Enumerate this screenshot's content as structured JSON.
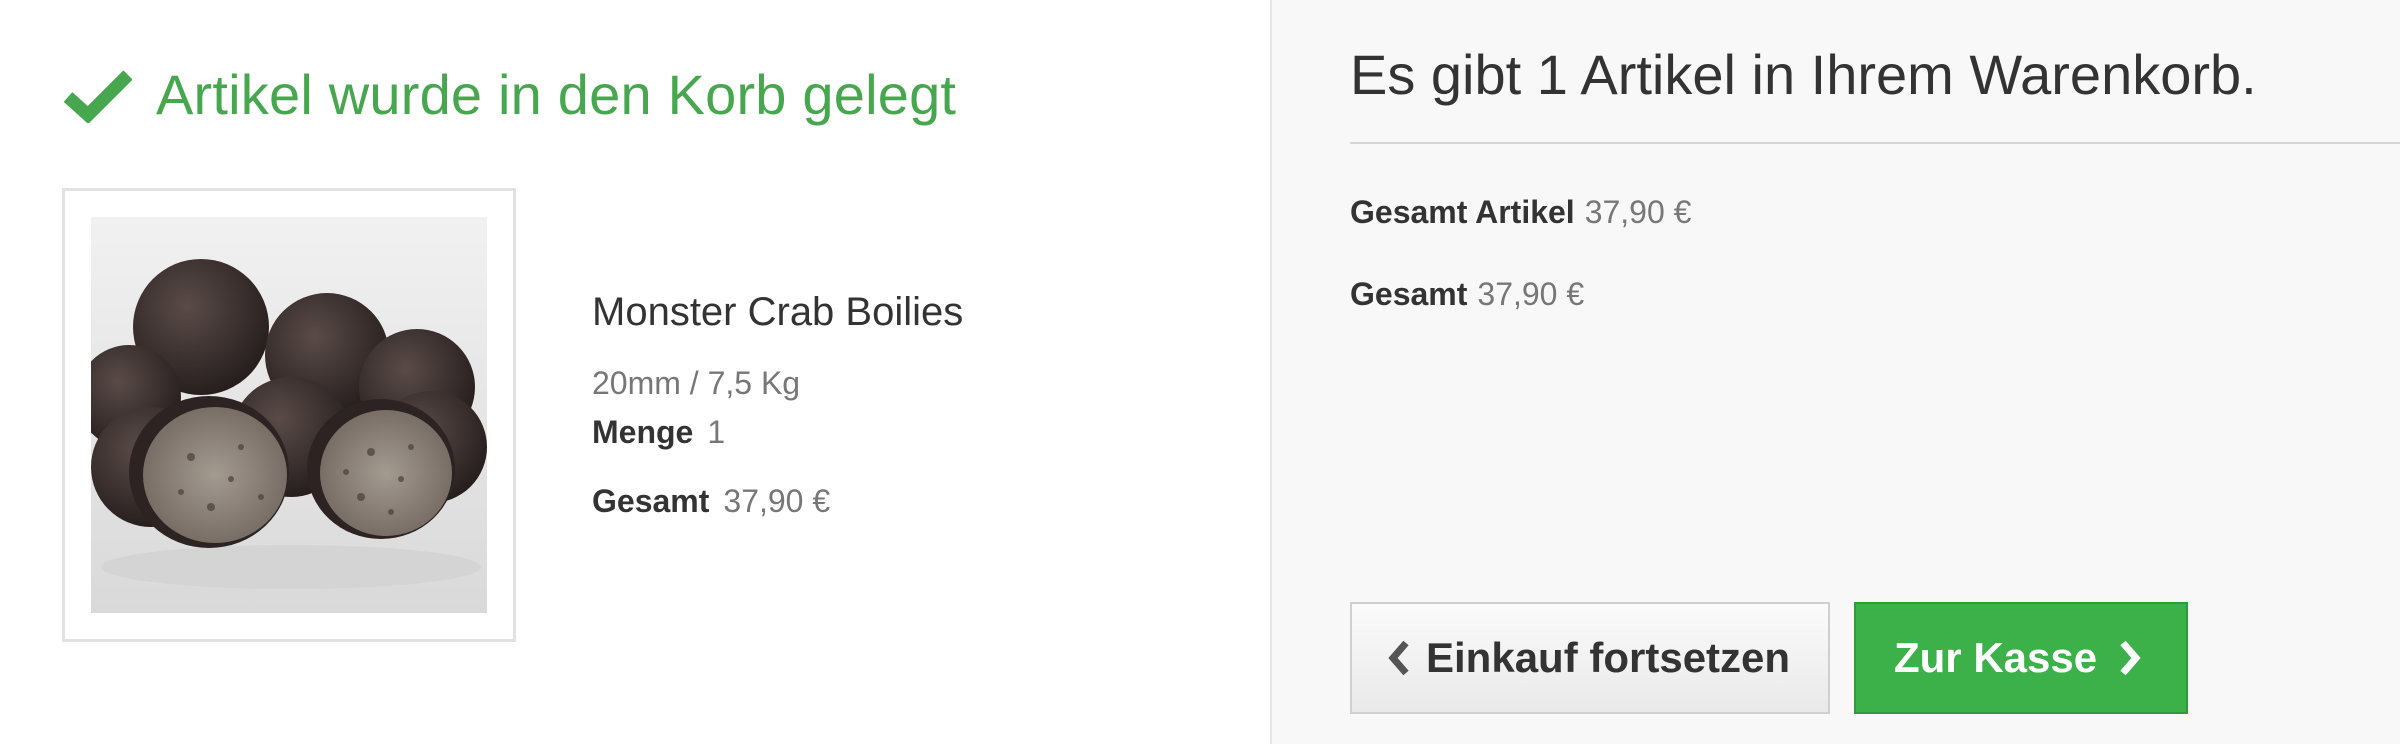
{
  "confirmation": {
    "icon": "checkmark-icon",
    "text": "Artikel wurde in den Korb gelegt",
    "color": "#46a74e"
  },
  "product": {
    "image_alt": "boilies-image",
    "name": "Monster Crab Boilies",
    "attributes": "20mm / 7,5 Kg",
    "quantity_label": "Menge",
    "quantity": "1",
    "total_label": "Gesamt",
    "total": "37,90 €"
  },
  "cart": {
    "title": "Es gibt 1 Artikel in Ihrem Warenkorb.",
    "items_total_label": "Gesamt Artikel",
    "items_total": "37,90 €",
    "grand_total_label": "Gesamt",
    "grand_total": "37,90 €"
  },
  "actions": {
    "continue_label": "Einkauf fortsetzen",
    "continue_icon": "chevron-left-icon",
    "checkout_label": "Zur Kasse",
    "checkout_icon": "chevron-right-icon",
    "checkout_color": "#3cb14a"
  }
}
